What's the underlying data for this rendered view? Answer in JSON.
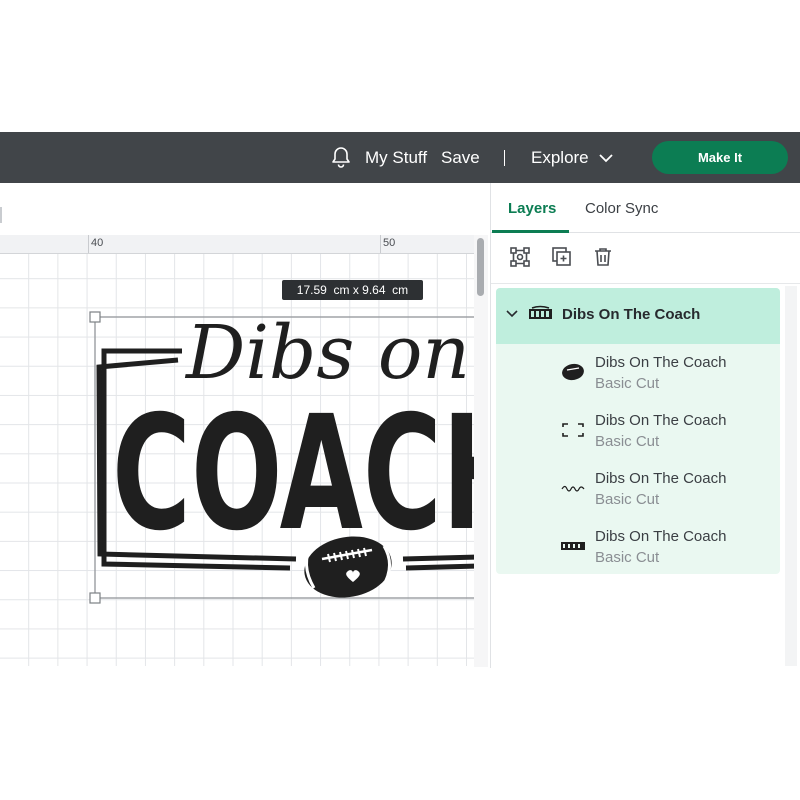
{
  "topbar": {
    "notifications_icon": "bell-icon",
    "my_stuff": "My Stuff",
    "save": "Save",
    "explore": "Explore",
    "make_it": "Make It",
    "accent": "#0c7d53",
    "bar_color": "#414549"
  },
  "canvas": {
    "ruler_labels": [
      "40",
      "50"
    ],
    "dimensions": "17.59  cm x 9.64  cm",
    "design_text_script": "Dibs on the",
    "design_text_block": "COACH"
  },
  "panel": {
    "tabs": [
      {
        "label": "Layers",
        "active": true
      },
      {
        "label": "Color Sync",
        "active": false
      }
    ],
    "tools": [
      "group-icon",
      "duplicate-icon",
      "delete-icon"
    ],
    "group": {
      "title": "Dibs On The Coach",
      "layers": [
        {
          "name": "Dibs On The Coach",
          "op": "Basic Cut",
          "thumb": "football-icon"
        },
        {
          "name": "Dibs On The Coach",
          "op": "Basic Cut",
          "thumb": "frame-icon"
        },
        {
          "name": "Dibs On The Coach",
          "op": "Basic Cut",
          "thumb": "script-text-icon"
        },
        {
          "name": "Dibs On The Coach",
          "op": "Basic Cut",
          "thumb": "coach-text-icon"
        }
      ]
    }
  }
}
